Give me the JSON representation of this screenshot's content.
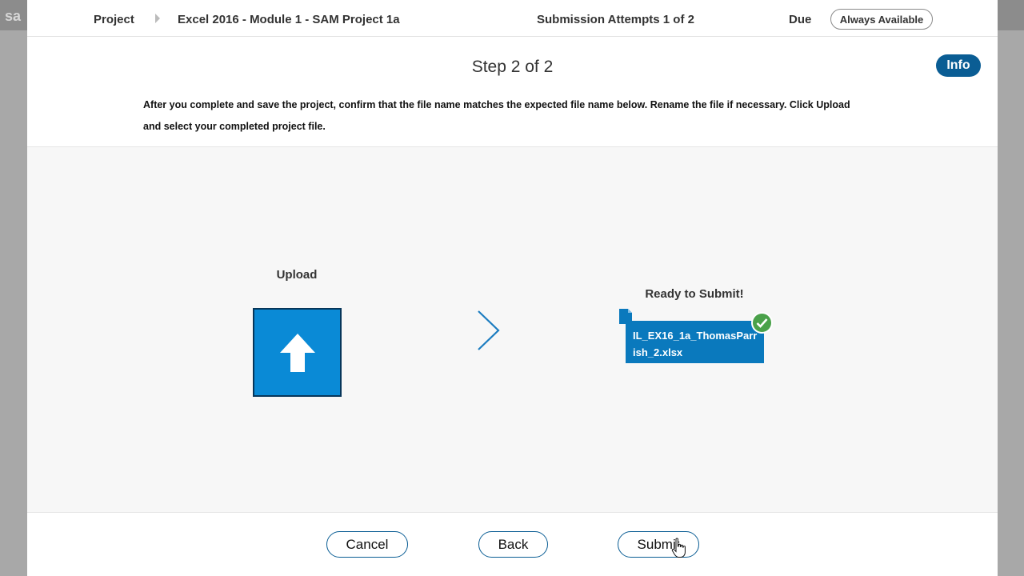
{
  "background": {
    "logo_text": "sa"
  },
  "header": {
    "project_label": "Project",
    "module_title": "Excel 2016 - Module 1 - SAM Project 1a",
    "attempts": "Submission Attempts 1 of 2",
    "due_label": "Due",
    "due_value": "Always Available"
  },
  "step": {
    "title": "Step 2 of 2",
    "info_label": "Info",
    "instructions_line1": "After you complete and save the project, confirm that the file name matches the expected file name below. Rename the file if necessary. Click Upload",
    "instructions_line2": "and select your completed project file."
  },
  "upload": {
    "label": "Upload",
    "ready_label": "Ready to Submit!",
    "file_name": "IL_EX16_1a_ThomasParrish_2.xlsx"
  },
  "footer": {
    "cancel_label": "Cancel",
    "back_label": "Back",
    "submit_label": "Submit"
  },
  "colors": {
    "accent": "#0a5d94",
    "upload_blue": "#0a8ad6",
    "file_blue": "#0a79bd",
    "success_green": "#4aa14a"
  }
}
